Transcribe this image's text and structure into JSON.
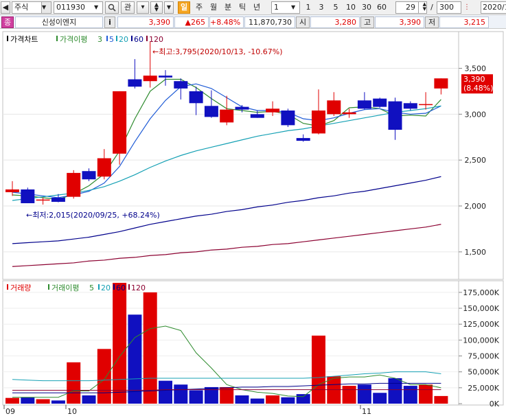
{
  "toolbar": {
    "market": "주식",
    "code": "011930",
    "search_icon": "search-icon",
    "gwan": "관",
    "periods": [
      "일",
      "주",
      "월",
      "분",
      "틱",
      "년"
    ],
    "active_period": "일",
    "interval_value": "1",
    "quick_intervals": [
      "1",
      "3",
      "5",
      "10",
      "30",
      "60"
    ],
    "count_value": "29",
    "count_separator": "/",
    "count_total": "300",
    "date_value": "2020/1"
  },
  "infobar": {
    "icon_label": "종",
    "stock_name": "신성이엔지",
    "info_button": "i",
    "price": "3,390",
    "change": "▲265",
    "change_pct": "+8.48%",
    "volume": "11,870,730",
    "open_label": "시",
    "open": "3,280",
    "high_label": "고",
    "high": "3,390",
    "low_label": "저",
    "low": "3,215"
  },
  "price_panel": {
    "legend_main": "가격차트",
    "legend_ma_label": "가격이평",
    "legend_ma_values": [
      "3",
      "5",
      "20",
      "60",
      "120"
    ],
    "annotation_high": "←최고:3,795(2020/10/13, -10.67%)",
    "annotation_low": "←최저:2,015(2020/09/25, +68.24%)",
    "y_ticks": [
      "3,500",
      "3,000",
      "2,500",
      "2,000",
      "1,500"
    ],
    "current_price_tag": "3,390",
    "current_pct_tag": "(8.48%)"
  },
  "volume_panel": {
    "legend_main": "거래량",
    "legend_ma_label": "거래이평",
    "legend_ma_values": [
      "5",
      "20",
      "60",
      "120"
    ],
    "y_ticks": [
      "175,000K",
      "150,000K",
      "125,000K",
      "100,000K",
      "75,000K",
      "50,000K",
      "25,000K",
      "0K"
    ]
  },
  "x_axis": {
    "labels": [
      "09",
      "10",
      "11"
    ]
  },
  "colors": {
    "up": "#e00000",
    "down": "#1010c0",
    "ma3": "#2e8b2e",
    "ma5": "#1e5bd6",
    "ma20": "#14a0b4",
    "ma60": "#00008b",
    "ma120": "#8b0030"
  },
  "chart_data": [
    {
      "type": "candlestick",
      "title": "가격차트",
      "ylim": [
        1200,
        3900
      ],
      "x_labels": [
        "09",
        "10",
        "11"
      ],
      "candles": [
        {
          "o": 2150,
          "h": 2270,
          "l": 2110,
          "c": 2180
        },
        {
          "o": 2180,
          "h": 2200,
          "l": 2030,
          "c": 2030
        },
        {
          "o": 2060,
          "h": 2090,
          "l": 2015,
          "c": 2070
        },
        {
          "o": 2090,
          "h": 2130,
          "l": 2040,
          "c": 2045
        },
        {
          "o": 2100,
          "h": 2390,
          "l": 2080,
          "c": 2360
        },
        {
          "o": 2380,
          "h": 2410,
          "l": 2270,
          "c": 2290
        },
        {
          "o": 2320,
          "h": 2620,
          "l": 2290,
          "c": 2520
        },
        {
          "o": 2570,
          "h": 3250,
          "l": 2450,
          "c": 3250
        },
        {
          "o": 3380,
          "h": 3600,
          "l": 3280,
          "c": 3300
        },
        {
          "o": 3360,
          "h": 3795,
          "l": 3290,
          "c": 3420
        },
        {
          "o": 3420,
          "h": 3480,
          "l": 3310,
          "c": 3400
        },
        {
          "o": 3360,
          "h": 3390,
          "l": 3160,
          "c": 3280
        },
        {
          "o": 3250,
          "h": 3300,
          "l": 2990,
          "c": 3120
        },
        {
          "o": 3090,
          "h": 3260,
          "l": 2960,
          "c": 2970
        },
        {
          "o": 2910,
          "h": 3200,
          "l": 2880,
          "c": 3050
        },
        {
          "o": 3080,
          "h": 3100,
          "l": 3020,
          "c": 3050
        },
        {
          "o": 3000,
          "h": 3040,
          "l": 2960,
          "c": 2960
        },
        {
          "o": 3020,
          "h": 3140,
          "l": 2980,
          "c": 3060
        },
        {
          "o": 3040,
          "h": 3060,
          "l": 2860,
          "c": 2880
        },
        {
          "o": 2740,
          "h": 2780,
          "l": 2700,
          "c": 2710
        },
        {
          "o": 2790,
          "h": 3270,
          "l": 2780,
          "c": 3040
        },
        {
          "o": 3000,
          "h": 3240,
          "l": 2980,
          "c": 3150
        },
        {
          "o": 3000,
          "h": 3060,
          "l": 2960,
          "c": 3020
        },
        {
          "o": 3150,
          "h": 3240,
          "l": 3050,
          "c": 3060
        },
        {
          "o": 3170,
          "h": 3180,
          "l": 3070,
          "c": 3080
        },
        {
          "o": 3140,
          "h": 3180,
          "l": 2720,
          "c": 2830
        },
        {
          "o": 3120,
          "h": 3140,
          "l": 3040,
          "c": 3060
        },
        {
          "o": 3110,
          "h": 3240,
          "l": 3050,
          "c": 3110
        },
        {
          "o": 3280,
          "h": 3390,
          "l": 3215,
          "c": 3390
        }
      ],
      "series": [
        {
          "name": "3",
          "values": [
            2120,
            2110,
            2090,
            2070,
            2130,
            2220,
            2350,
            2600,
            2950,
            3250,
            3380,
            3380,
            3290,
            3170,
            3060,
            3040,
            3020,
            3030,
            3000,
            2900,
            2870,
            2930,
            3070,
            3080,
            3060,
            2980,
            2990,
            2980,
            3160
          ]
        },
        {
          "name": "5",
          "values": [
            2150,
            2130,
            2110,
            2090,
            2120,
            2160,
            2250,
            2430,
            2700,
            2950,
            3150,
            3300,
            3330,
            3280,
            3180,
            3080,
            3040,
            3040,
            3020,
            2950,
            2930,
            2960,
            3010,
            3050,
            3060,
            3020,
            3000,
            3010,
            3090
          ]
        },
        {
          "name": "20",
          "values": [
            2060,
            2080,
            2100,
            2120,
            2140,
            2170,
            2210,
            2270,
            2340,
            2420,
            2490,
            2550,
            2600,
            2640,
            2680,
            2720,
            2760,
            2790,
            2820,
            2840,
            2870,
            2900,
            2930,
            2960,
            2990,
            3020,
            3040,
            3060,
            3090
          ]
        },
        {
          "name": "60",
          "values": [
            1590,
            1600,
            1610,
            1620,
            1640,
            1660,
            1690,
            1720,
            1760,
            1800,
            1830,
            1860,
            1890,
            1910,
            1940,
            1960,
            1990,
            2010,
            2040,
            2060,
            2090,
            2110,
            2140,
            2160,
            2190,
            2220,
            2250,
            2280,
            2320
          ]
        },
        {
          "name": "120",
          "values": [
            1340,
            1350,
            1360,
            1370,
            1380,
            1400,
            1410,
            1430,
            1440,
            1460,
            1470,
            1490,
            1500,
            1520,
            1530,
            1550,
            1560,
            1580,
            1590,
            1610,
            1630,
            1650,
            1670,
            1690,
            1710,
            1730,
            1750,
            1770,
            1800
          ]
        }
      ]
    },
    {
      "type": "bar",
      "title": "거래량",
      "ylim": [
        0,
        190000
      ],
      "unit": "K",
      "values": [
        9000,
        10000,
        7000,
        5000,
        65000,
        13000,
        86000,
        190000,
        140000,
        175000,
        36000,
        30000,
        21000,
        26000,
        26000,
        13000,
        8000,
        13000,
        10000,
        15000,
        107000,
        43000,
        28000,
        30000,
        17000,
        40000,
        28000,
        30000,
        12000
      ],
      "series": [
        {
          "name": "5",
          "values": [
            10000,
            10000,
            10000,
            10000,
            20000,
            20000,
            38000,
            74000,
            104000,
            118000,
            122000,
            115000,
            80000,
            56000,
            30000,
            22000,
            18000,
            16000,
            12000,
            11000,
            30000,
            40000,
            42000,
            42000,
            45000,
            40000,
            30000,
            30000,
            25000
          ]
        },
        {
          "name": "20",
          "values": [
            38000,
            37000,
            36000,
            36000,
            36000,
            36000,
            37000,
            38000,
            39000,
            40000,
            40000,
            40000,
            40000,
            40000,
            40000,
            40000,
            40000,
            40000,
            40000,
            40000,
            41000,
            43000,
            45000,
            47000,
            48000,
            50000,
            50000,
            50000,
            47000
          ]
        },
        {
          "name": "60",
          "values": [
            17000,
            17000,
            17000,
            17000,
            17000,
            17000,
            17000,
            18000,
            19000,
            20000,
            21000,
            22000,
            23000,
            24000,
            25000,
            26000,
            26000,
            27000,
            27000,
            28000,
            29000,
            30000,
            31000,
            31000,
            32000,
            32000,
            32000,
            32000,
            32000
          ]
        },
        {
          "name": "120",
          "values": [
            21000,
            21000,
            21000,
            21000,
            21000,
            21000,
            21000,
            21000,
            21000,
            21000,
            22000,
            22000,
            22000,
            22000,
            22000,
            22000,
            22000,
            22000,
            22000,
            22000,
            22000,
            22000,
            22000,
            22000,
            22000,
            22000,
            22000,
            22000,
            22000
          ]
        }
      ]
    }
  ]
}
